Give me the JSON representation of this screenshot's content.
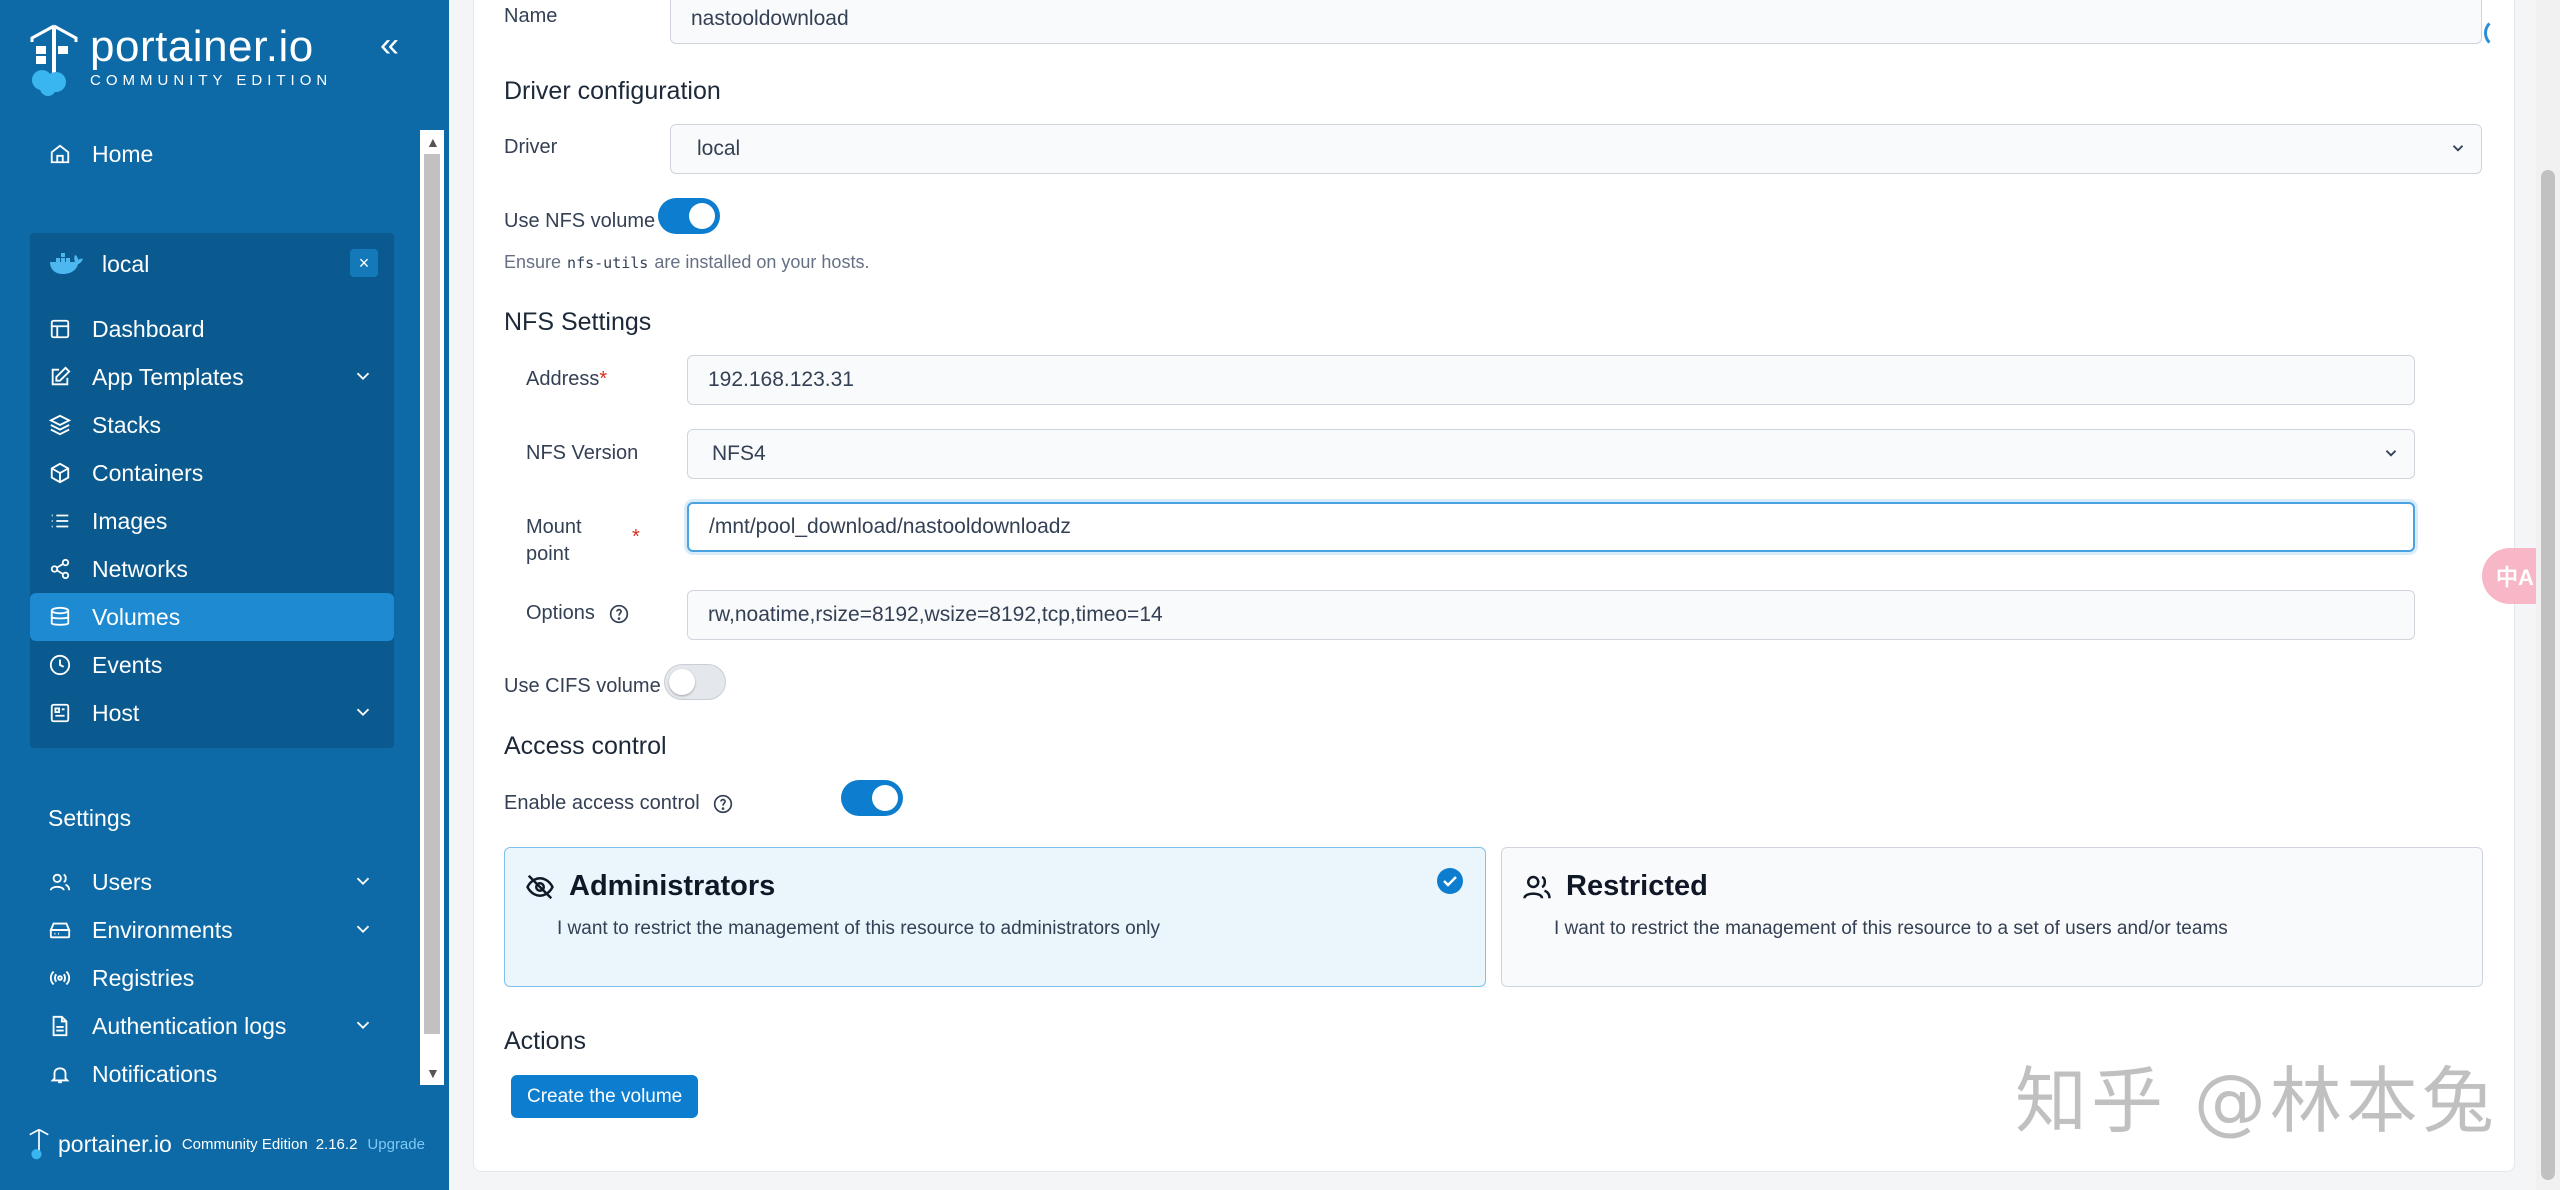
{
  "sidebar": {
    "brand_name": "portainer.io",
    "brand_sub": "COMMUNITY EDITION",
    "home_label": "Home",
    "environment": {
      "name": "local",
      "close_label": "×"
    },
    "env_items": [
      {
        "label": "Dashboard",
        "icon": "dashboard-icon"
      },
      {
        "label": "App Templates",
        "icon": "edit-icon",
        "expandable": true
      },
      {
        "label": "Stacks",
        "icon": "layers-icon"
      },
      {
        "label": "Containers",
        "icon": "box-icon"
      },
      {
        "label": "Images",
        "icon": "list-icon"
      },
      {
        "label": "Networks",
        "icon": "share-icon"
      },
      {
        "label": "Volumes",
        "icon": "database-icon",
        "active": true
      },
      {
        "label": "Events",
        "icon": "clock-icon"
      },
      {
        "label": "Host",
        "icon": "server-icon",
        "expandable": true
      }
    ],
    "settings_label": "Settings",
    "settings_items": [
      {
        "label": "Users",
        "icon": "users-icon",
        "expandable": true
      },
      {
        "label": "Environments",
        "icon": "hard-drive-icon",
        "expandable": true
      },
      {
        "label": "Registries",
        "icon": "radio-icon"
      },
      {
        "label": "Authentication logs",
        "icon": "file-text-icon",
        "expandable": true
      },
      {
        "label": "Notifications",
        "icon": "bell-icon"
      }
    ],
    "footer": {
      "brand": "portainer.io",
      "edition": "Community Edition",
      "version": "2.16.2",
      "upgrade_label": "Upgrade"
    }
  },
  "form": {
    "name_label": "Name",
    "name_value": "nastooldownload",
    "driver_section": "Driver configuration",
    "driver_label": "Driver",
    "driver_value": "local",
    "nfs_toggle_label": "Use NFS volume",
    "nfs_enabled": true,
    "nfs_hint_pre": "Ensure",
    "nfs_hint_code": "nfs-utils",
    "nfs_hint_post": "are installed on your hosts.",
    "nfs_section": "NFS Settings",
    "address_label": "Address",
    "address_value": "192.168.123.31",
    "nfs_version_label": "NFS Version",
    "nfs_version_value": "NFS4",
    "mount_label_line1": "Mount",
    "mount_label_line2": "point",
    "required_mark": "*",
    "mount_value": "/mnt/pool_download/nastooldownloadz",
    "options_label": "Options",
    "options_value": "rw,noatime,rsize=8192,wsize=8192,tcp,timeo=14",
    "cifs_toggle_label": "Use CIFS volume",
    "cifs_enabled": false,
    "access_section": "Access control",
    "access_toggle_label": "Enable access control",
    "access_enabled": true,
    "admin_option": {
      "title": "Administrators",
      "desc": "I want to restrict the management of this resource to administrators only",
      "selected": true
    },
    "restricted_option": {
      "title": "Restricted",
      "desc": "I want to restrict the management of this resource to a set of users and/or teams",
      "selected": false
    },
    "actions_section": "Actions",
    "create_button": "Create the volume"
  },
  "overlays": {
    "translate_label": "中A",
    "watermark": "知乎 @林本兔"
  },
  "colors": {
    "sidebar": "#0d6aa6",
    "active_item": "#1d8ad2",
    "primary": "#0d7ecf"
  }
}
